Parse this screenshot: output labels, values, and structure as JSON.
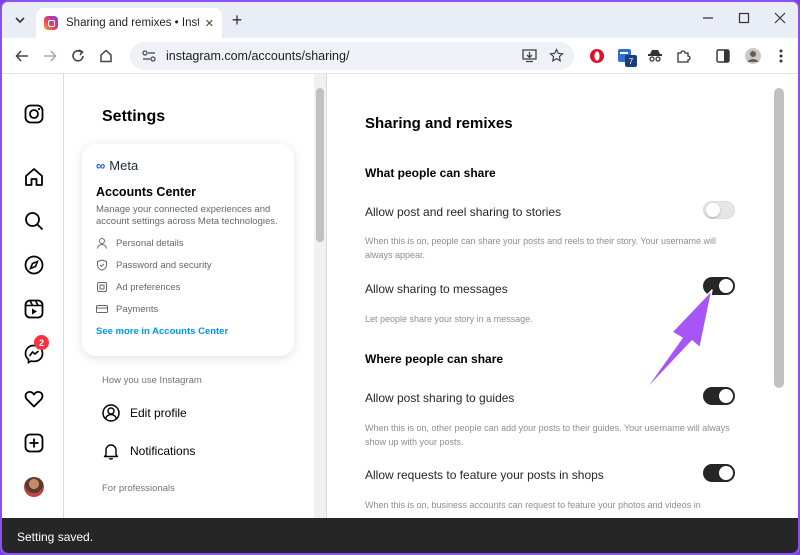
{
  "browser": {
    "tab_title": "Sharing and remixes • Instagram",
    "url": "instagram.com/accounts/sharing/",
    "extension_badge": "7",
    "new_tab_symbol": "+",
    "tab_close_symbol": "✕"
  },
  "rail": {
    "messages_badge": "2"
  },
  "settings": {
    "title": "Settings",
    "accounts_center": {
      "brand": "Meta",
      "title": "Accounts Center",
      "description": "Manage your connected experiences and account settings across Meta technologies.",
      "items": [
        "Personal details",
        "Password and security",
        "Ad preferences",
        "Payments"
      ],
      "link": "See more in Accounts Center"
    },
    "section_how": "How you use Instagram",
    "items": [
      "Edit profile",
      "Notifications"
    ],
    "section_pro": "For professionals"
  },
  "main": {
    "title": "Sharing and remixes",
    "groups": [
      {
        "title": "What people can share",
        "settings": [
          {
            "label": "Allow post and reel sharing to stories",
            "desc": "When this is on, people can share your posts and reels to their story. Your username will always appear.",
            "on": false
          },
          {
            "label": "Allow sharing to messages",
            "desc": "Let people share your story in a message.",
            "on": true
          }
        ]
      },
      {
        "title": "Where people can share",
        "settings": [
          {
            "label": "Allow post sharing to guides",
            "desc": "When this is on, other people can add your posts to their guides. Your username will always show up with your posts.",
            "on": true
          },
          {
            "label": "Allow requests to feature your posts in shops",
            "desc": "When this is on, business accounts can request to feature your photos and videos in",
            "on": true
          }
        ]
      }
    ]
  },
  "toast": "Setting saved.",
  "colors": {
    "annotation_arrow": "#a855f7",
    "toggle_on": "#262626",
    "link": "#0095f6"
  }
}
